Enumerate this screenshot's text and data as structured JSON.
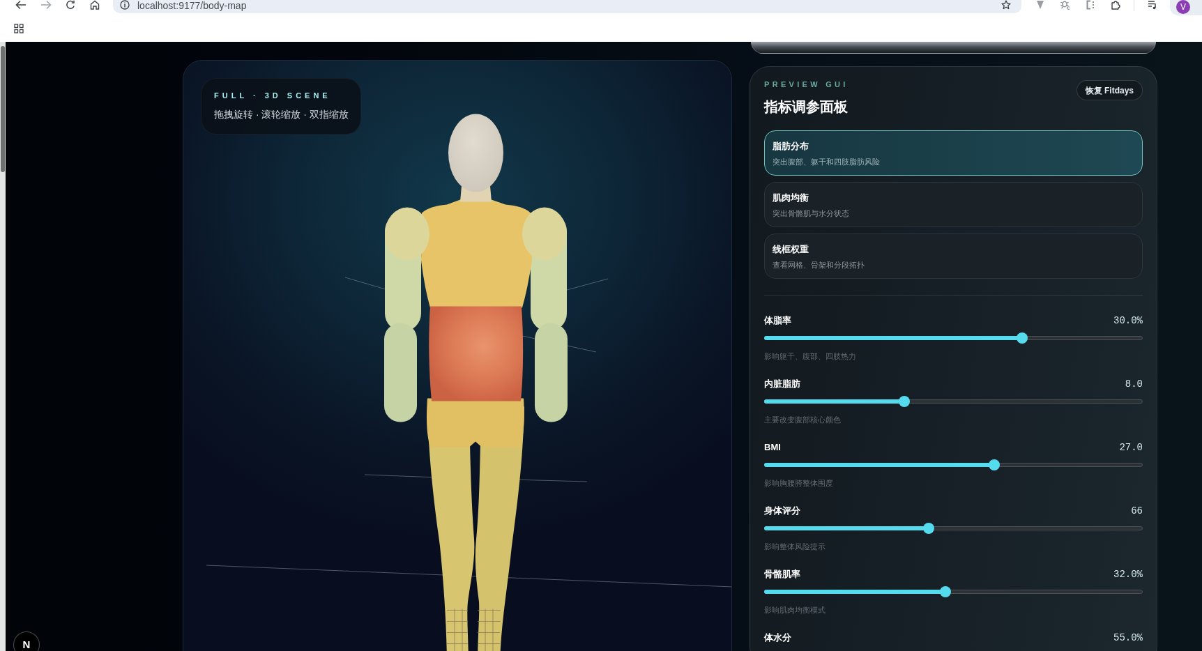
{
  "browser": {
    "url": "localhost:9177/body-map",
    "profile_initial": "V"
  },
  "scene": {
    "label": "FULL · 3D SCENE",
    "hint": "拖拽旋转 · 滚轮缩放 · 双指缩放"
  },
  "dev_indicator": "N",
  "panel": {
    "eyebrow": "PREVIEW GUI",
    "title": "指标调参面板",
    "reset_button": "恢复 Fitdays",
    "modes": [
      {
        "title": "脂肪分布",
        "description": "突出腹部、躯干和四肢脂肪风险",
        "selected": true
      },
      {
        "title": "肌肉均衡",
        "description": "突出骨骼肌与水分状态",
        "selected": false
      },
      {
        "title": "线框权重",
        "description": "查看网格、骨架和分段拓扑",
        "selected": false
      }
    ],
    "sliders": [
      {
        "label": "体脂率",
        "value": "30.0%",
        "level": 0.681,
        "hint": "影响躯干、腹部、四肢热力"
      },
      {
        "label": "内脏脂肪",
        "value": "8.0",
        "level": 0.37,
        "hint": "主要改变腹部核心颜色"
      },
      {
        "label": "BMI",
        "value": "27.0",
        "level": 0.607,
        "hint": "影响胸腰胯整体围度"
      },
      {
        "label": "身体评分",
        "value": "66",
        "level": 0.435,
        "hint": "影响整体风险提示"
      },
      {
        "label": "骨骼肌率",
        "value": "32.0%",
        "level": 0.479,
        "hint": "影响肌肉均衡模式"
      },
      {
        "label": "体水分",
        "value": "55.0%"
      }
    ]
  }
}
